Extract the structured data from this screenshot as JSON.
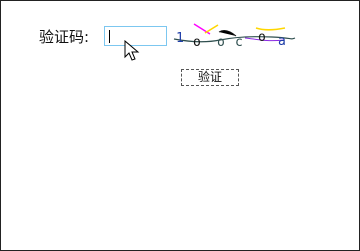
{
  "form": {
    "captcha_label": "验证码:",
    "captcha_input_value": "",
    "verify_button_label": "验证"
  },
  "captcha_image": {
    "text": "1o-oc.oa",
    "colors": [
      "#1f3ea8",
      "#ff00ff",
      "#111111",
      "#ffd700",
      "#2f4f4f"
    ]
  },
  "icons": {
    "cursor": "mouse-pointer-icon"
  }
}
